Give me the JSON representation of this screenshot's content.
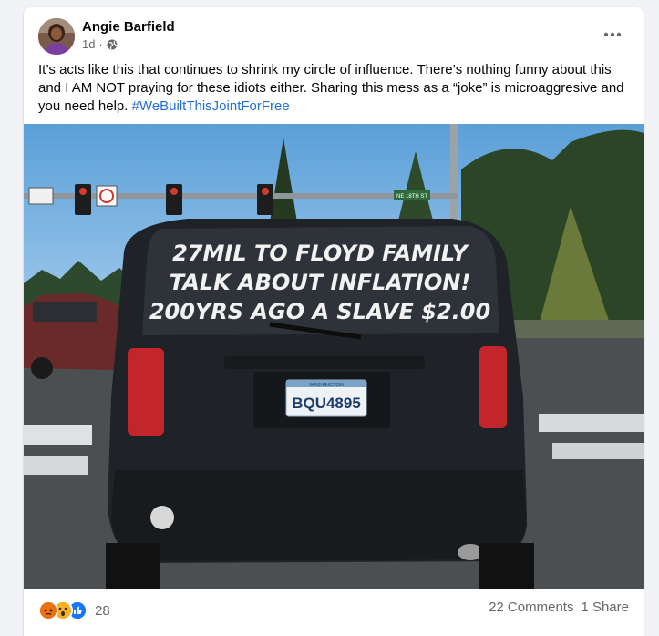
{
  "post": {
    "author": "Angie Barfield",
    "time": "1d",
    "privacy_icon": "globe-icon",
    "text_main": "It’s acts like this that continues to shrink my circle of influence. There’s nothing funny about this and I AM NOT praying for these idiots either. Sharing this mess as a “joke” is microaggresive and you need help. ",
    "hashtag": "#WeBuiltThisJointForFree",
    "more_icon": "more-options-icon"
  },
  "photo": {
    "window_lines": [
      "27MIL TO FLOYD FAMILY",
      "TALK ABOUT INFLATION!",
      "200YRS AGO A SLAVE $2.00"
    ],
    "plate_state": "WASHINGTON",
    "plate_number": "BQU4895",
    "street_sign": "NE 18TH ST"
  },
  "footer": {
    "reactions": [
      "angry",
      "wow",
      "like"
    ],
    "reaction_count": "28",
    "comments": "22 Comments",
    "shares": "1 Share"
  },
  "colors": {
    "link": "#216fdb",
    "secondary_text": "#65676b",
    "like": "#1877f2",
    "angry": "#e9710f",
    "wow": "#f7b125"
  }
}
